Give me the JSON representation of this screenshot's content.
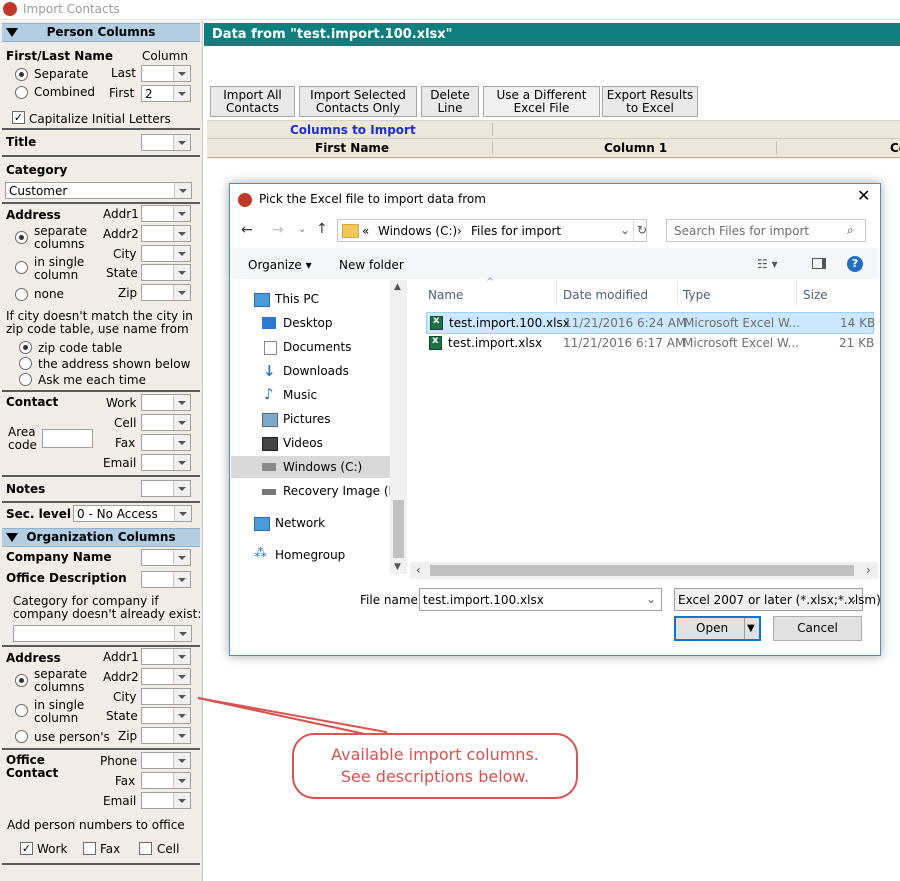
{
  "window": {
    "title": "Import Contacts"
  },
  "left": {
    "person_columns": "Person Columns",
    "first_last_name": "First/Last Name",
    "column": "Column",
    "separate": "Separate",
    "combined": "Combined",
    "last": "Last",
    "first": "First",
    "first_value": "2",
    "capitalize": "Capitalize Initial Letters",
    "title": "Title",
    "category": "Category",
    "category_value": "Customer",
    "address": "Address",
    "addr1": "Addr1",
    "addr2": "Addr2",
    "city": "City",
    "state": "State",
    "zip": "Zip",
    "separate_columns_1": "separate",
    "separate_columns_2": "columns",
    "in_single_1": "in single",
    "in_single_2": "column",
    "none": "none",
    "city_note_1": "If city doesn't match the city in",
    "city_note_2": "zip code table, use name from",
    "zip_table": "zip code table",
    "addr_below": "the address shown below",
    "ask_each": "Ask me each time",
    "contact": "Contact",
    "work": "Work",
    "cell": "Cell",
    "fax": "Fax",
    "email": "Email",
    "area_code_1": "Area",
    "area_code_2": "code",
    "notes": "Notes",
    "sec_level": "Sec. level",
    "sec_level_value": "0 - No Access",
    "org_columns": "Organization Columns",
    "company_name": "Company Name",
    "office_description": "Office Description",
    "cat_company_1": "Category for company if",
    "cat_company_2": "company doesn't already exist:",
    "use_persons": "use person's",
    "office_contact_1": "Office",
    "office_contact_2": "Contact",
    "phone": "Phone",
    "add_person_numbers": "Add person numbers to office",
    "opt_work": "Work",
    "opt_fax": "Fax",
    "opt_cell": "Cell"
  },
  "main": {
    "data_header": "Data from \"test.import.100.xlsx\"",
    "buttons": {
      "import_all_1": "Import All",
      "import_all_2": "Contacts",
      "import_selected_1": "Import Selected",
      "import_selected_2": "Contacts Only",
      "delete_1": "Delete",
      "delete_2": "Line",
      "use_different_1": "Use a Different",
      "use_different_2": "Excel File",
      "export_1": "Export Results",
      "export_2": "to Excel"
    },
    "columns_to_import": "Columns to Import",
    "first_name": "First Name",
    "column_1": "Column 1",
    "col_partial": "Co"
  },
  "dialog": {
    "title": "Pick the Excel file to import data from",
    "path_prefix": "«",
    "path_drive": "Windows (C:)",
    "path_folder": "Files for import",
    "search_placeholder": "Search Files for import",
    "organize": "Organize",
    "new_folder": "New folder",
    "nav": [
      "This PC",
      "Desktop",
      "Documents",
      "Downloads",
      "Music",
      "Pictures",
      "Videos",
      "Windows (C:)",
      "Recovery Image (D:)",
      "Network",
      "Homegroup"
    ],
    "headers": {
      "name": "Name",
      "date": "Date modified",
      "type": "Type",
      "size": "Size"
    },
    "files": [
      {
        "name": "test.import.100.xlsx",
        "date": "11/21/2016 6:24 AM",
        "type": "Microsoft Excel W...",
        "size": "14 KB"
      },
      {
        "name": "test.import.xlsx",
        "date": "11/21/2016 6:17 AM",
        "type": "Microsoft Excel W...",
        "size": "21 KB"
      }
    ],
    "file_name_label": "File name:",
    "file_name_value": "test.import.100.xlsx",
    "file_type": "Excel 2007 or later (*.xlsx;*.xlsm)",
    "open": "Open",
    "cancel": "Cancel"
  },
  "callout": {
    "line1": "Available import columns.",
    "line2": "See descriptions below."
  }
}
